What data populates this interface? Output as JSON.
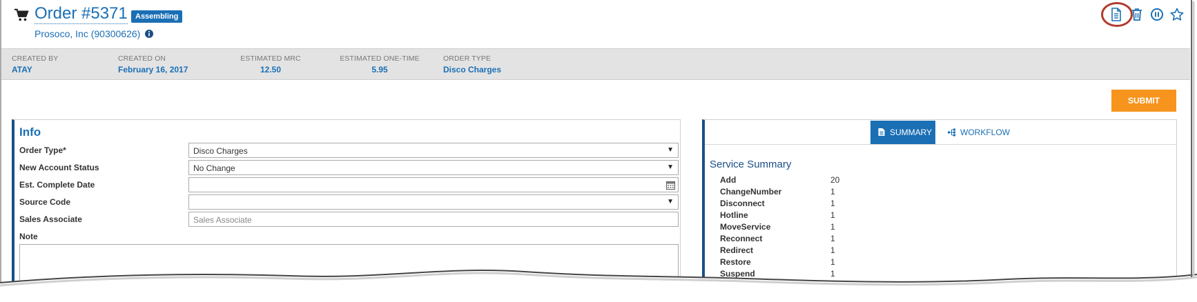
{
  "header": {
    "order_title": "Order #5371",
    "status_badge": "Assembling",
    "customer": "Prosoco, Inc (90300626)"
  },
  "header_actions": [
    {
      "name": "document-icon"
    },
    {
      "name": "trash-icon"
    },
    {
      "name": "pause-icon"
    },
    {
      "name": "star-icon"
    }
  ],
  "meta": {
    "created_by": {
      "label": "CREATED BY",
      "value": "ATAY"
    },
    "created_on": {
      "label": "CREATED ON",
      "value": "February 16, 2017"
    },
    "est_mrc": {
      "label": "ESTIMATED MRC",
      "value": "12.50"
    },
    "est_one_time": {
      "label": "ESTIMATED ONE-TIME",
      "value": "5.95"
    },
    "order_type": {
      "label": "ORDER TYPE",
      "value": "Disco Charges"
    }
  },
  "actions": {
    "submit_label": "SUBMIT"
  },
  "info": {
    "title": "Info",
    "fields": {
      "order_type": {
        "label": "Order Type*",
        "value": "Disco Charges"
      },
      "account_status": {
        "label": "New Account Status",
        "value": "No Change"
      },
      "complete_date": {
        "label": "Est. Complete Date",
        "value": ""
      },
      "source_code": {
        "label": "Source Code",
        "value": ""
      },
      "sales_associate": {
        "label": "Sales Associate",
        "placeholder": "Sales Associate"
      },
      "note": {
        "label": "Note"
      }
    }
  },
  "summary": {
    "tabs": {
      "summary": "SUMMARY",
      "workflow": "WORKFLOW"
    },
    "title": "Service Summary",
    "rows": [
      {
        "name": "Add",
        "value": "20"
      },
      {
        "name": "ChangeNumber",
        "value": "1"
      },
      {
        "name": "Disconnect",
        "value": "1"
      },
      {
        "name": "Hotline",
        "value": "1"
      },
      {
        "name": "MoveService",
        "value": "1"
      },
      {
        "name": "Reconnect",
        "value": "1"
      },
      {
        "name": "Redirect",
        "value": "1"
      },
      {
        "name": "Restore",
        "value": "1"
      },
      {
        "name": "Suspend",
        "value": "1"
      }
    ]
  },
  "colors": {
    "accent": "#1a6fb5",
    "panel_border": "#1a4f86",
    "submit": "#f7941d",
    "highlight_ring": "#b03a2e"
  }
}
